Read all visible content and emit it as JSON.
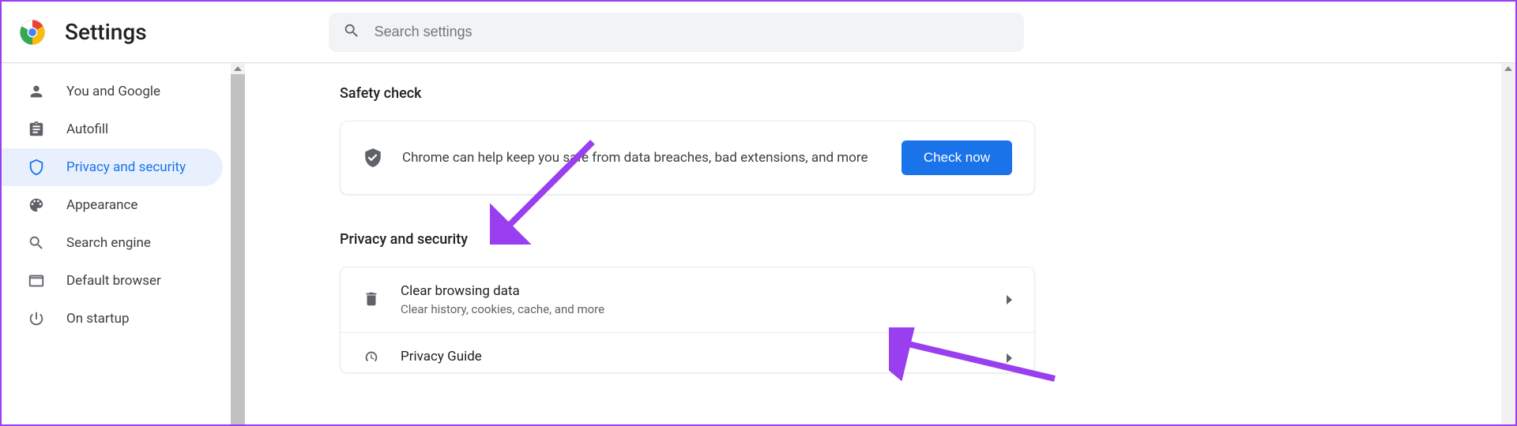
{
  "header": {
    "title": "Settings",
    "search_placeholder": "Search settings"
  },
  "sidebar": {
    "items": [
      {
        "id": "you-and-google",
        "label": "You and Google",
        "icon": "person-icon",
        "active": false
      },
      {
        "id": "autofill",
        "label": "Autofill",
        "icon": "clipboard-icon",
        "active": false
      },
      {
        "id": "privacy-and-security",
        "label": "Privacy and security",
        "icon": "shield-icon",
        "active": true
      },
      {
        "id": "appearance",
        "label": "Appearance",
        "icon": "palette-icon",
        "active": false
      },
      {
        "id": "search-engine",
        "label": "Search engine",
        "icon": "search-icon",
        "active": false
      },
      {
        "id": "default-browser",
        "label": "Default browser",
        "icon": "browser-icon",
        "active": false
      },
      {
        "id": "on-startup",
        "label": "On startup",
        "icon": "power-icon",
        "active": false
      }
    ]
  },
  "sections": {
    "safety_check": {
      "title": "Safety check",
      "description": "Chrome can help keep you safe from data breaches, bad extensions, and more",
      "button_label": "Check now"
    },
    "privacy_security": {
      "title": "Privacy and security",
      "rows": [
        {
          "id": "clear-browsing-data",
          "title": "Clear browsing data",
          "subtitle": "Clear history, cookies, cache, and more",
          "icon": "trash-icon"
        },
        {
          "id": "privacy-guide",
          "title": "Privacy Guide",
          "subtitle": "",
          "icon": "gauge-icon"
        }
      ]
    }
  },
  "annotation": {
    "color": "#9a3fef"
  }
}
